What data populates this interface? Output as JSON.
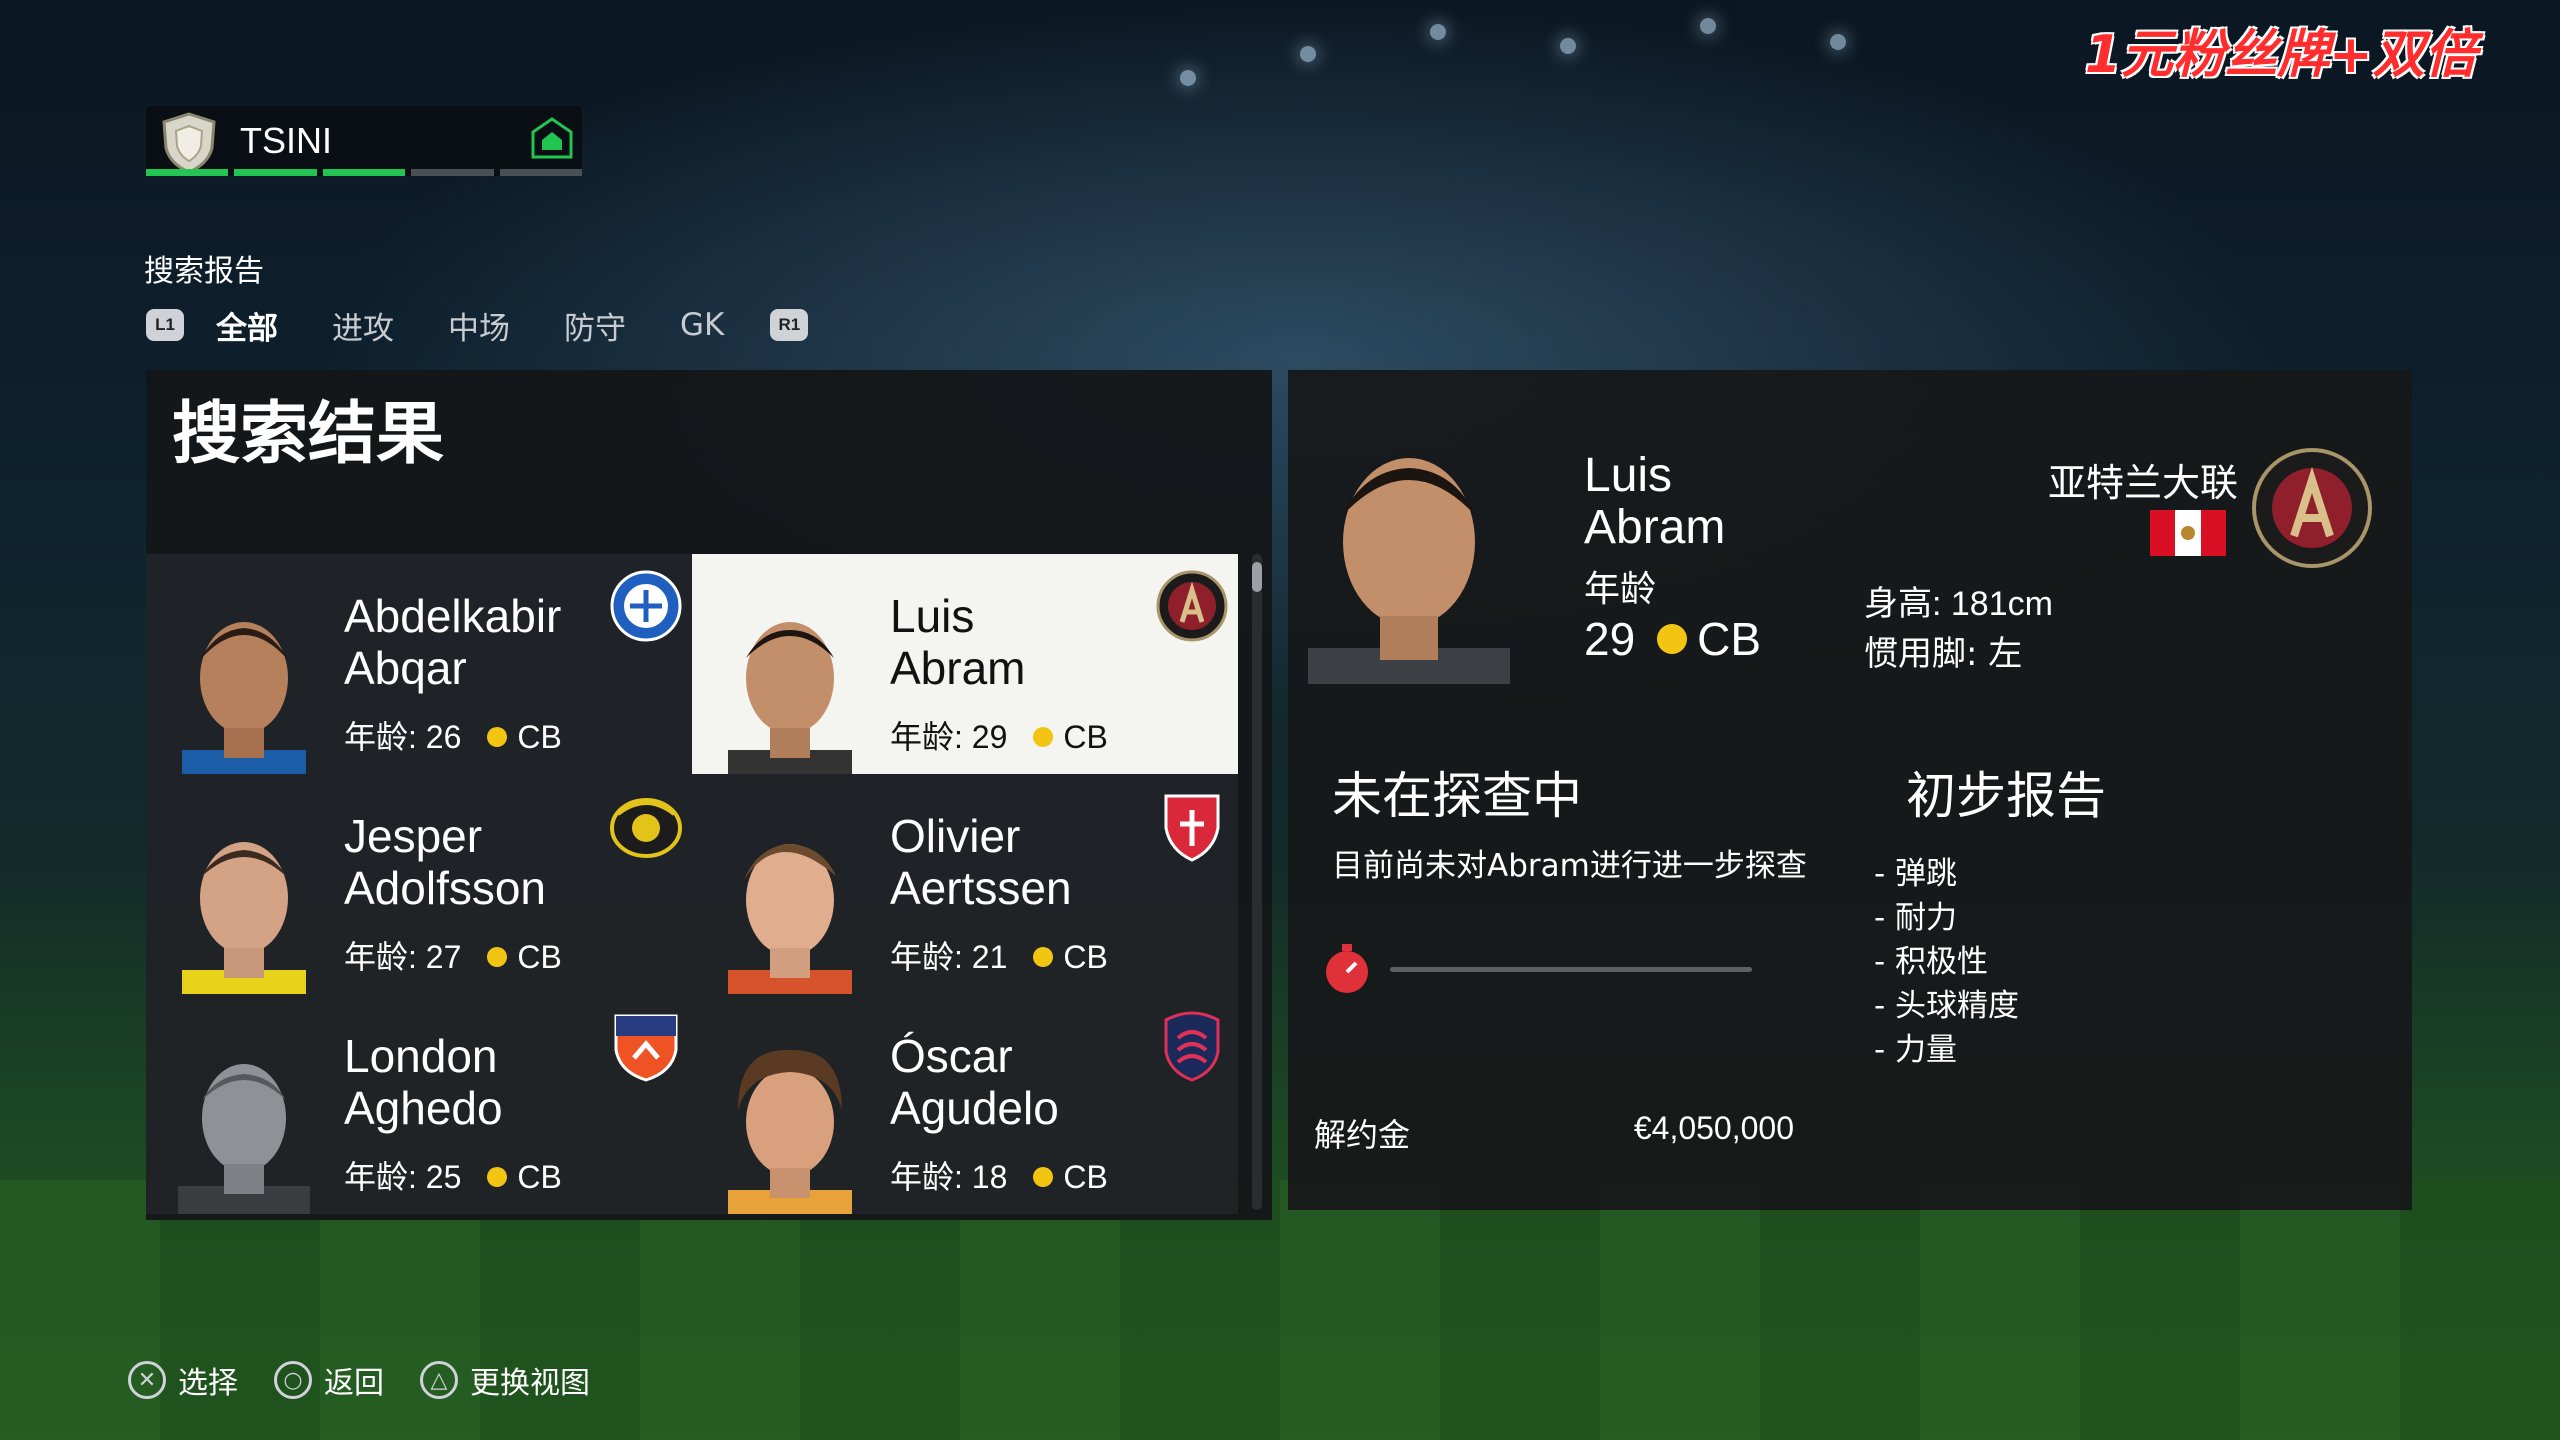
{
  "watermark": "1元粉丝牌+双倍",
  "club": {
    "name": "TSINI",
    "badge_icon": "shield-crest-icon",
    "home_icon": "home-icon"
  },
  "section_label": "搜索报告",
  "tabs": {
    "prev_button": "L1",
    "next_button": "R1",
    "items": [
      "全部",
      "进攻",
      "中场",
      "防守",
      "GK"
    ],
    "active": "全部"
  },
  "results": {
    "title": "搜索结果",
    "players": [
      {
        "first": "Abdelkabir",
        "last": "Abqar",
        "age_text": "年龄: 26",
        "position": "CB",
        "crest": "alaves-crest-icon"
      },
      {
        "first": "Luis",
        "last": "Abram",
        "age_text": "年龄: 29",
        "position": "CB",
        "crest": "atlanta-united-crest-icon",
        "selected": true
      },
      {
        "first": "Jesper",
        "last": "Adolfsson",
        "age_text": "年龄: 27",
        "position": "CB",
        "crest": "mjallby-crest-icon"
      },
      {
        "first": "Olivier",
        "last": "Aertssen",
        "age_text": "年龄: 21",
        "position": "CB",
        "crest": "monza-crest-icon"
      },
      {
        "first": "London",
        "last": "Aghedo",
        "age_text": "年龄: 25",
        "position": "CB",
        "crest": "fc-cincinnati-crest-icon"
      },
      {
        "first": "Óscar",
        "last": "Agudelo",
        "age_text": "年龄: 18",
        "position": "CB",
        "crest": "st-louis-city-crest-icon"
      }
    ]
  },
  "detail": {
    "first": "Luis",
    "last": "Abram",
    "age_label": "年龄",
    "age": "29",
    "position": "CB",
    "club": "亚特兰大联",
    "nationality_flag": "peru-flag-icon",
    "height": "身高: 181cm",
    "foot": "惯用脚: 左",
    "scout_status": "未在探查中",
    "scout_desc": "目前尚未对Abram进行进一步探查",
    "scout_progress": 0,
    "report_title": "初步报告",
    "report_items": [
      "弹跳",
      "耐力",
      "积极性",
      "头球精度",
      "力量"
    ],
    "release_label": "解约金",
    "release_value": "€4,050,000"
  },
  "footer": [
    {
      "glyph": "✕",
      "label": "选择",
      "icon": "cross-button-icon"
    },
    {
      "glyph": "○",
      "label": "返回",
      "icon": "circle-button-icon"
    },
    {
      "glyph": "△",
      "label": "更换视图",
      "icon": "triangle-button-icon"
    }
  ],
  "colors": {
    "accent_green": "#23c552",
    "position_dot": "#f2c513",
    "watermark_red": "#ff2d2d"
  }
}
